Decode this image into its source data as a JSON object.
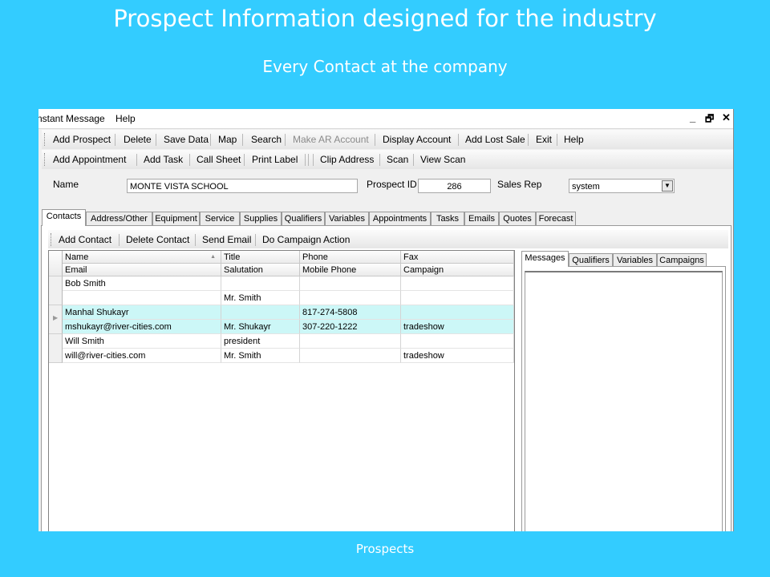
{
  "slide": {
    "title": "Prospect Information designed for the industry",
    "subtitle": "Every Contact at the company",
    "footer": "Prospects"
  },
  "menubar": {
    "items": [
      "nstant Message",
      "Help"
    ],
    "controls": {
      "minimize": "_",
      "restore": "🗗",
      "close": "✕"
    }
  },
  "toolbar1": [
    "Add Prospect",
    "Delete",
    "Save Data",
    "Map",
    "Search",
    "Make AR Account",
    "Display Account",
    "Add Lost Sale",
    "Exit",
    "Help"
  ],
  "toolbar2": [
    "Add Appointment",
    "Add Task",
    "Call Sheet",
    "Print Label",
    "Clip Address",
    "Scan",
    "View Scan"
  ],
  "form": {
    "name_label": "Name",
    "name_value": "MONTE VISTA SCHOOL",
    "prospect_id_label": "Prospect ID",
    "prospect_id_value": "286",
    "sales_rep_label": "Sales Rep",
    "sales_rep_value": "system"
  },
  "tabs": [
    "Contacts",
    "Address/Other",
    "Equipment",
    "Service",
    "Supplies",
    "Qualifiers",
    "Variables",
    "Appointments",
    "Tasks",
    "Emails",
    "Quotes",
    "Forecast"
  ],
  "contacts_toolbar": [
    "Add Contact",
    "Delete Contact",
    "Send Email",
    "Do Campaign Action"
  ],
  "grid": {
    "headers_row1": [
      "Name",
      "Title",
      "Phone",
      "Fax"
    ],
    "headers_row2": [
      "Email",
      "Salutation",
      "Mobile Phone",
      "Campaign"
    ],
    "rows": [
      [
        "Bob Smith",
        "",
        "",
        ""
      ],
      [
        "",
        "Mr. Smith",
        "",
        ""
      ],
      [
        "Manhal Shukayr",
        "",
        "817-274-5808",
        ""
      ],
      [
        "mshukayr@river-cities.com",
        "Mr. Shukayr",
        "307-220-1222",
        "tradeshow"
      ],
      [
        "Will Smith",
        "president",
        "",
        ""
      ],
      [
        "will@river-cities.com",
        "Mr. Smith",
        "",
        "tradeshow"
      ]
    ]
  },
  "right_tabs": [
    "Messages",
    "Qualifiers",
    "Variables",
    "Campaigns"
  ]
}
